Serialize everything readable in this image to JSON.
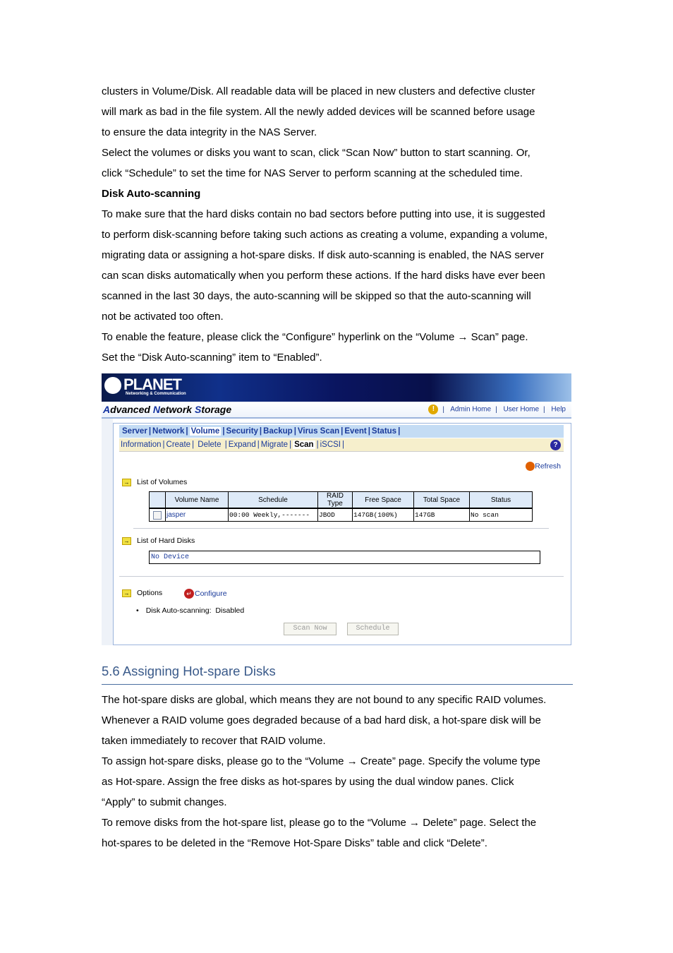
{
  "doc": {
    "top_paragraph_lines": [
      "clusters in Volume/Disk. All readable data will be placed in new clusters and defective cluster",
      "will mark as bad in the file system. All the newly added devices will be scanned before usage",
      "to ensure the data integrity in the NAS Server.",
      "Select the volumes or disks you want to scan, click “Scan Now” button to start scanning. Or,",
      "click “Schedule” to set the time for NAS Server to perform scanning at the scheduled time."
    ],
    "subheading": "Disk Auto-scanning",
    "auto_paragraph_lines": [
      "To make sure that the hard disks contain no bad sectors before putting into use, it is suggested",
      "to perform disk-scanning before taking such actions as creating a volume, expanding a volume,",
      "migrating data or assigning a hot-spare disks. If disk auto-scanning is enabled, the NAS server",
      "can scan disks automatically when you perform these actions. If the hard disks have ever been",
      "scanned in the last 30 days, the auto-scanning will be skipped so that the auto-scanning will",
      "not be activated too often.",
      "To enable the feature, please click the “Configure” hyperlink on the “Volume → Scan” page.",
      "Set the “Disk Auto-scanning” item to “Enabled”."
    ],
    "section_heading": "5.6 Assigning Hot-spare Disks",
    "hotspare_lines": [
      "The hot-spare disks are global, which means they are not bound to any specific RAID volumes.",
      "Whenever a RAID volume goes degraded because of a bad hard disk, a hot-spare disk will be",
      "taken immediately to recover that RAID volume.",
      "To assign hot-spare disks, please go to the “Volume → Create” page. Specify the volume type",
      "as Hot-spare. Assign the free disks as hot-spares by using the dual window panes. Click",
      "“Apply” to submit changes.",
      "To remove disks from the hot-spare list, please go to the “Volume → Delete” page. Select the",
      "hot-spares to be deleted in the “Remove Hot-Spare Disks” table and click “Delete”."
    ]
  },
  "ui": {
    "logo": "PLANET",
    "logo_sub": "Networking & Communication",
    "app_title": {
      "a": "A",
      "b": "dvanced ",
      "c": "N",
      "d": "etwork ",
      "e": "S",
      "f": "torage"
    },
    "top_links": [
      "Admin Home",
      "User Home",
      "Help"
    ],
    "main_tabs": [
      "Server",
      "Network",
      "Volume",
      "Security",
      "Backup",
      "Virus Scan",
      "Event",
      "Status"
    ],
    "active_main_tab": "Volume",
    "sub_tabs": [
      "Information",
      "Create",
      "Delete",
      "Expand",
      "Migrate",
      "Scan",
      "iSCSI"
    ],
    "active_sub_tab": "Scan",
    "refresh_label": "Refresh",
    "volumes_title": "List of Volumes",
    "volume_columns": [
      "",
      "Volume Name",
      "Schedule",
      "RAID Type",
      "Free Space",
      "Total Space",
      "Status"
    ],
    "volume_rows": [
      {
        "name": "jasper",
        "schedule": "00:00 Weekly,-------",
        "raid": "JBOD",
        "free": "147GB(100%)",
        "total": "147GB",
        "status": "No scan"
      }
    ],
    "disks_title": "List of Hard Disks",
    "no_device": "No Device",
    "options_title": "Options",
    "configure_label": "Configure",
    "auto_scan_label": "Disk Auto-scanning:",
    "auto_scan_value": "Disabled",
    "scan_now_label": "Scan Now",
    "schedule_label": "Schedule"
  }
}
